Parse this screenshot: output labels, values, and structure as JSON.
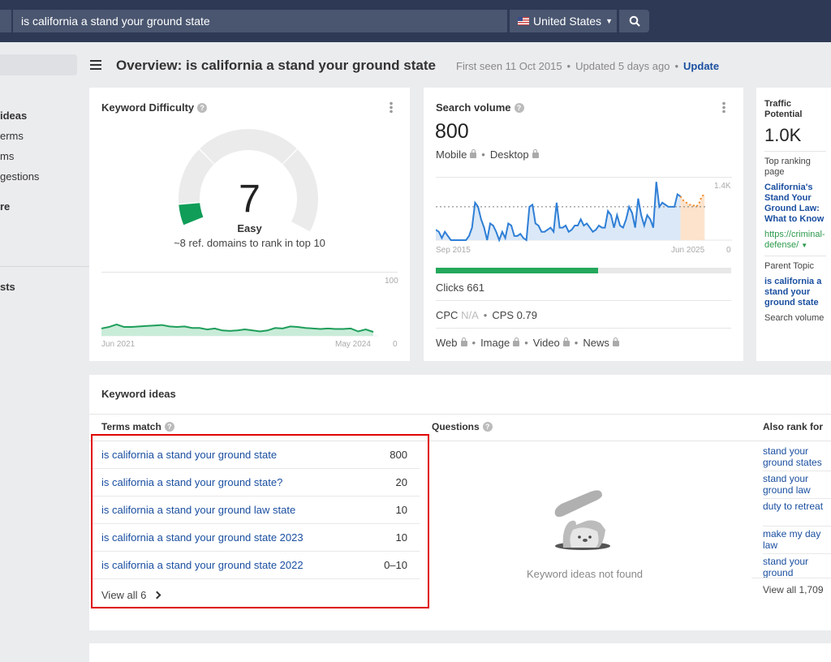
{
  "topbar": {
    "query": "is california a stand your ground state",
    "country": "United States",
    "flag_icon": "us-flag-icon",
    "search_icon": "search-icon"
  },
  "sidebar": {
    "items": [
      {
        "label": "ideas",
        "bold": true
      },
      {
        "label": "erms"
      },
      {
        "label": "ms"
      },
      {
        "label": "gestions"
      },
      {
        "label": "re",
        "bold": true
      },
      {
        "label": "sts",
        "bold": true
      }
    ]
  },
  "header": {
    "title": "Overview: is california a stand your ground state",
    "first_seen": "First seen 11 Oct 2015",
    "updated": "Updated 5 days ago",
    "update_link": "Update"
  },
  "kd": {
    "title": "Keyword Difficulty",
    "value": "7",
    "value_num": 7,
    "label": "Easy",
    "sub": "~8 ref. domains to rank in top 10",
    "color": "#0f9d58",
    "trend": {
      "x_start": "Jun 2021",
      "x_end": "May 2024",
      "y_max": "100",
      "y_min": "0",
      "values": [
        15,
        18,
        23,
        18,
        18,
        19,
        20,
        21,
        22,
        19,
        18,
        19,
        16,
        16,
        13,
        15,
        11,
        10,
        11,
        13,
        11,
        9,
        11,
        16,
        15,
        19,
        18,
        16,
        15,
        14,
        15,
        14,
        14,
        15,
        9,
        13,
        8
      ]
    }
  },
  "sv": {
    "title": "Search volume",
    "value": "800",
    "mobile": "Mobile",
    "desktop": "Desktop",
    "trend": {
      "x_start": "Sep 2015",
      "x_end": "Jun 2025",
      "y_max": "1.4K",
      "y_min": "0",
      "average": 800,
      "max_value": 1500,
      "values": [
        250,
        200,
        50,
        200,
        100,
        0,
        0,
        0,
        0,
        0,
        0,
        100,
        300,
        900,
        800,
        500,
        300,
        0,
        400,
        350,
        200,
        0,
        200,
        50,
        400,
        350,
        100,
        100,
        150,
        50,
        0,
        800,
        850,
        400,
        350,
        200,
        200,
        250,
        300,
        200,
        900,
        300,
        300,
        350,
        200,
        250,
        350,
        350,
        500,
        350,
        400,
        300,
        200,
        250,
        350,
        300,
        300,
        700,
        600,
        300,
        600,
        350,
        300,
        500,
        800,
        650,
        300,
        1000,
        600,
        350,
        600,
        500,
        300,
        1400,
        800,
        900,
        850,
        800,
        800,
        800,
        1100,
        1050
      ],
      "forecast": [
        1050,
        950,
        900,
        850,
        850,
        800,
        850,
        1050,
        1100
      ]
    },
    "clicks_label": "Clicks 661",
    "clicks_fraction": 0.55,
    "cpc_label": "CPC",
    "cpc_value": "N/A",
    "cps": "CPS 0.79",
    "serp_types": [
      "Web",
      "Image",
      "Video",
      "News"
    ]
  },
  "tp": {
    "title": "Traffic Potential",
    "value": "1.0K",
    "top_ranking": "Top ranking page",
    "page_title": "California's Stand Your Ground Law: What to Know",
    "url": "https://criminal-defense/",
    "parent_topic": "Parent Topic",
    "parent_value": "is california a stand your ground state",
    "search_volume": "Search volume"
  },
  "ideas": {
    "title": "Keyword ideas",
    "terms": {
      "header": "Terms match",
      "rows": [
        {
          "kw": "is california a stand your ground state",
          "vol": "800"
        },
        {
          "kw": "is california a stand your ground state?",
          "vol": "20"
        },
        {
          "kw": "is california a stand your ground law state",
          "vol": "10"
        },
        {
          "kw": "is california a stand your ground state 2023",
          "vol": "10"
        },
        {
          "kw": "is california a stand your ground state 2022",
          "vol": "0–10"
        }
      ],
      "view_all": "View all 6"
    },
    "questions": {
      "header": "Questions",
      "empty": "Keyword ideas not found"
    },
    "also": {
      "header": "Also rank for",
      "rows": [
        "stand your ground states",
        "stand your ground law",
        "duty to retreat",
        "make my day law",
        "stand your ground"
      ],
      "view_all": "View all 1,709"
    }
  },
  "highlight_color": "#e00000"
}
